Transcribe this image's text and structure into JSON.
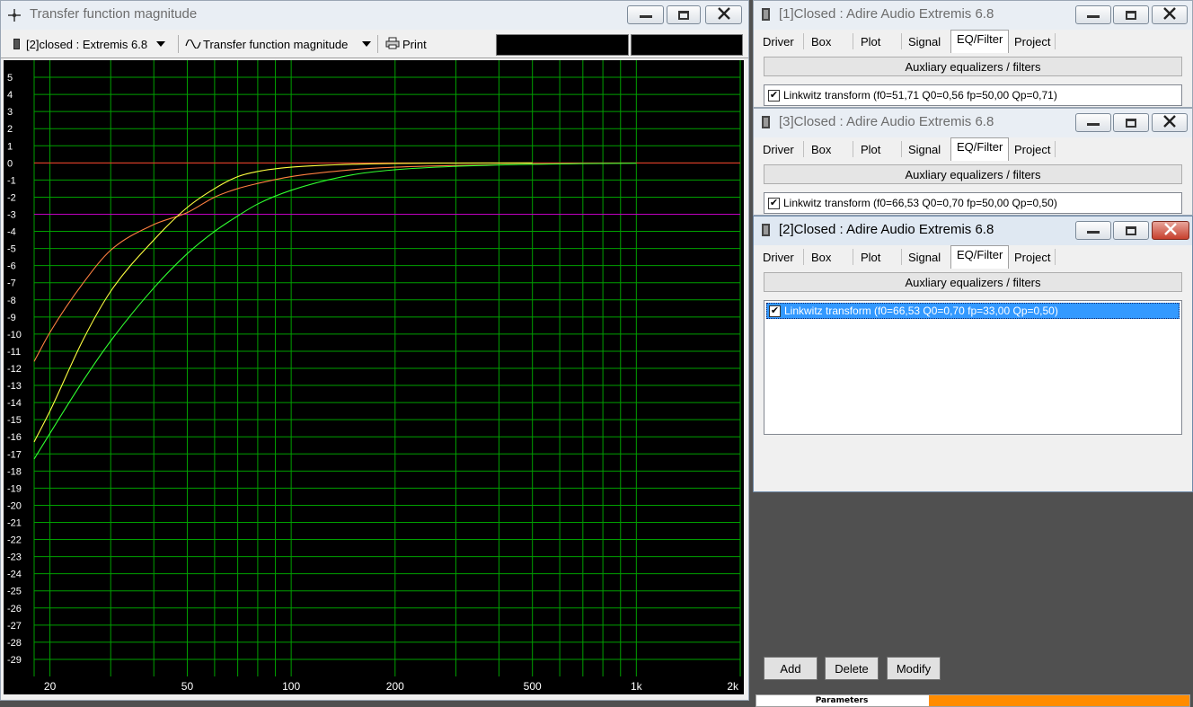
{
  "plot_window": {
    "title": "Transfer function magnitude",
    "toolbar": {
      "project_select": "[2]closed : Extremis 6.8",
      "view_select": "Transfer function magnitude",
      "print_label": "Print"
    }
  },
  "chart_data": {
    "type": "line",
    "title": "",
    "xlabel": "",
    "ylabel": "",
    "x_scale": "log",
    "xlim": [
      18,
      2000
    ],
    "ylim": [
      -30,
      6
    ],
    "grid": true,
    "background": "#000000",
    "grid_color": "#00a000",
    "x_tick_labels": [
      {
        "value": 20,
        "label": "20"
      },
      {
        "value": 50,
        "label": "50"
      },
      {
        "value": 100,
        "label": "100"
      },
      {
        "value": 200,
        "label": "200"
      },
      {
        "value": 500,
        "label": "500"
      },
      {
        "value": 1000,
        "label": "1k"
      },
      {
        "value": 2000,
        "label": "2k"
      }
    ],
    "y_tick_labels": [
      "5",
      "4",
      "3",
      "2",
      "1",
      "0",
      "-1",
      "-2",
      "-3",
      "-4",
      "-5",
      "-6",
      "-7",
      "-8",
      "-9",
      "-10",
      "-11",
      "-12",
      "-13",
      "-14",
      "-15",
      "-16",
      "-17",
      "-18",
      "-19",
      "-20",
      "-21",
      "-22",
      "-23",
      "-24",
      "-25",
      "-26",
      "-27",
      "-28",
      "-29"
    ],
    "reference_lines": [
      {
        "y": 0,
        "color": "#ff3030"
      },
      {
        "y": -3,
        "color": "#c000c0"
      }
    ],
    "series": [
      {
        "color": "#ff8040",
        "x": [
          18,
          20,
          25,
          30,
          40,
          50,
          60,
          70,
          80,
          100,
          150,
          200,
          300,
          500,
          700
        ],
        "y": [
          -11.6,
          -9.9,
          -7.0,
          -5.1,
          -3.6,
          -2.9,
          -2.0,
          -1.5,
          -1.2,
          -0.8,
          -0.4,
          -0.25,
          -0.15,
          -0.07,
          -0.03
        ]
      },
      {
        "color": "#ffff40",
        "x": [
          18,
          20,
          25,
          30,
          40,
          50,
          60,
          70,
          80,
          100,
          150,
          200,
          300,
          500
        ],
        "y": [
          -16.3,
          -14.5,
          -10.3,
          -7.5,
          -4.5,
          -2.6,
          -1.5,
          -0.8,
          -0.5,
          -0.25,
          -0.08,
          -0.03,
          -0.01,
          0.0
        ]
      },
      {
        "color": "#30ff30",
        "x": [
          18,
          20,
          25,
          30,
          40,
          50,
          60,
          70,
          80,
          100,
          150,
          200,
          300,
          500,
          700,
          1000
        ],
        "y": [
          -17.3,
          -15.8,
          -12.7,
          -10.4,
          -7.3,
          -5.3,
          -4.0,
          -3.1,
          -2.4,
          -1.6,
          -0.7,
          -0.4,
          -0.2,
          -0.08,
          -0.04,
          -0.02
        ]
      }
    ]
  },
  "proj1": {
    "title": "[1]Closed : Adire Audio Extremis 6.8",
    "tabs": [
      "Driver",
      "Box",
      "Plot",
      "Signal",
      "EQ/Filter",
      "Project"
    ],
    "header_button": "Auxliary equalizers / filters",
    "items": [
      {
        "label": "Linkwitz transform (f0=51,71 Q0=0,56 fp=50,00 Qp=0,71)",
        "check": "✔"
      }
    ]
  },
  "proj3": {
    "title": "[3]Closed : Adire Audio Extremis 6.8",
    "tabs": [
      "Driver",
      "Box",
      "Plot",
      "Signal",
      "EQ/Filter",
      "Project"
    ],
    "header_button": "Auxliary equalizers / filters",
    "items": [
      {
        "label": "Linkwitz transform (f0=66,53 Q0=0,70 fp=50,00 Qp=0,50)",
        "check": "✔"
      }
    ]
  },
  "proj2": {
    "title": "[2]Closed : Adire Audio Extremis 6.8",
    "tabs": [
      "Driver",
      "Box",
      "Plot",
      "Signal",
      "EQ/Filter",
      "Project"
    ],
    "header_button": "Auxliary equalizers / filters",
    "items": [
      {
        "label": "Linkwitz transform (f0=66,53 Q0=0,70 fp=33,00 Qp=0,50)",
        "check": "✔"
      }
    ],
    "buttons": {
      "add": "Add",
      "delete": "Delete",
      "modify": "Modify"
    },
    "status_label": "Parameters",
    "status_color": "#ff8c00"
  }
}
